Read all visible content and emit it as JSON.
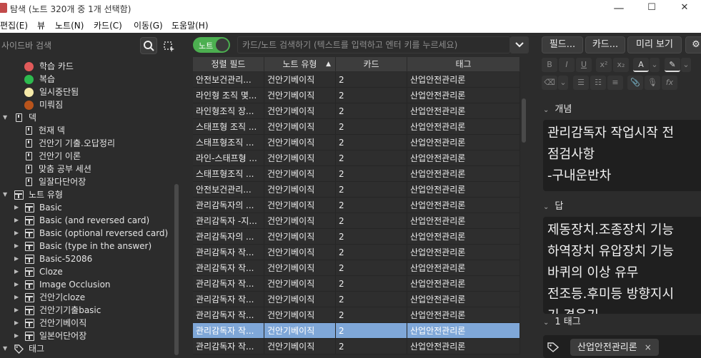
{
  "window": {
    "title": "탐색 (노트 320개 중 1개 선택함)",
    "minimize": "—",
    "maximize": "☐",
    "close": "✕"
  },
  "menu": [
    "편집(E)",
    "뷰",
    "노트(N)",
    "카드(C)",
    "이동(G)",
    "도움말(H)"
  ],
  "sidebar": {
    "search_placeholder": "사이드바 검색",
    "items": [
      {
        "label": "학습 카드",
        "icon": "red-dot-icon",
        "color": "#e05a5a"
      },
      {
        "label": "복습",
        "icon": "green-dot-icon",
        "color": "#2dba4e"
      },
      {
        "label": "일시중단됨",
        "icon": "yellow-dot-icon",
        "color": "#f5e9a8"
      },
      {
        "label": "미뤄짐",
        "icon": "brown-dot-icon",
        "color": "#b9541b"
      },
      {
        "label": "덱",
        "icon": "deck-icon"
      },
      {
        "label": "현재 덱",
        "icon": "current-deck-icon"
      },
      {
        "label": "건안기 기출.오답정리",
        "icon": "deck-icon"
      },
      {
        "label": "건안기 이론",
        "icon": "deck-icon"
      },
      {
        "label": "맞춤 공부 세션",
        "icon": "filtered-deck-icon"
      },
      {
        "label": "일잘다단어장",
        "icon": "deck-icon"
      },
      {
        "label": "노트 유형",
        "icon": "note-type-icon"
      },
      {
        "label": "Basic",
        "icon": "note-type-icon"
      },
      {
        "label": "Basic (and reversed card)",
        "icon": "note-type-icon"
      },
      {
        "label": "Basic (optional reversed card)",
        "icon": "note-type-icon"
      },
      {
        "label": "Basic (type in the answer)",
        "icon": "note-type-icon"
      },
      {
        "label": "Basic-52086",
        "icon": "note-type-icon"
      },
      {
        "label": "Cloze",
        "icon": "note-type-icon"
      },
      {
        "label": "Image Occlusion",
        "icon": "note-type-icon"
      },
      {
        "label": "건안기cloze",
        "icon": "note-type-icon"
      },
      {
        "label": "건안기기출basic",
        "icon": "note-type-icon"
      },
      {
        "label": "건안기베이직",
        "icon": "note-type-icon"
      },
      {
        "label": "일본어단어장",
        "icon": "note-type-icon"
      },
      {
        "label": "태그",
        "icon": "tag-icon"
      }
    ]
  },
  "browser": {
    "toggle_label": "노트",
    "search_placeholder": "카드/노트 검색하기 (텍스트를 입력하고 엔터 키를 누르세요)",
    "columns": [
      "정렬 필드",
      "노트 유형",
      "카드",
      "태그"
    ],
    "sort_indicator": "▲",
    "rows": [
      [
        "안전보건관리...",
        "건안기베이직",
        "2",
        "산업안전관리론"
      ],
      [
        "라인형 조직 몇...",
        "건안기베이직",
        "2",
        "산업안전관리론"
      ],
      [
        "라인형조직 장...",
        "건안기베이직",
        "2",
        "산업안전관리론"
      ],
      [
        "스태프형 조직 ...",
        "건안기베이직",
        "2",
        "산업안전관리론"
      ],
      [
        "스태프형조직 ...",
        "건안기베이직",
        "2",
        "산업안전관리론"
      ],
      [
        "라인-스태프형 ...",
        "건안기베이직",
        "2",
        "산업안전관리론"
      ],
      [
        "스태프형조직 ...",
        "건안기베이직",
        "2",
        "산업안전관리론"
      ],
      [
        "안전보건관리...",
        "건안기베이직",
        "2",
        "산업안전관리론"
      ],
      [
        "관리감독자의 ...",
        "건안기베이직",
        "2",
        "산업안전관리론"
      ],
      [
        "관리감독자 -지...",
        "건안기베이직",
        "2",
        "산업안전관리론"
      ],
      [
        "관리감독자의 ...",
        "건안기베이직",
        "2",
        "산업안전관리론"
      ],
      [
        "관리감독자 작...",
        "건안기베이직",
        "2",
        "산업안전관리론"
      ],
      [
        "관리감독자 작...",
        "건안기베이직",
        "2",
        "산업안전관리론"
      ],
      [
        "관리감독자 작...",
        "건안기베이직",
        "2",
        "산업안전관리론"
      ],
      [
        "관리감독자 작...",
        "건안기베이직",
        "2",
        "산업안전관리론"
      ],
      [
        "관리감독자 작...",
        "건안기베이직",
        "2",
        "산업안전관리론"
      ],
      [
        "관리감독자 작...",
        "건안기베이직",
        "2",
        "산업안전관리론"
      ],
      [
        "관리감독자 작...",
        "건안기베이직",
        "2",
        "산업안전관리론"
      ]
    ],
    "selected_row": 16
  },
  "editor": {
    "buttons": [
      "필드...",
      "카드...",
      "미리 보기"
    ],
    "gear": "⚙",
    "format_row1": [
      "B",
      "I",
      "U",
      "x²",
      "x₂",
      "A",
      "⌄",
      "✎",
      "⌄"
    ],
    "format_row2": [
      "⌫",
      "⌄",
      "☰",
      "☷",
      "≡",
      "📎",
      "🎙",
      "fx"
    ],
    "fields": [
      {
        "name": "개념",
        "lines": [
          "관리감독자 작업시작 전",
          "점검사항",
          "-구내운반차"
        ]
      },
      {
        "name": "답",
        "lines": [
          "제동장치.조종장치 기능",
          "하역장치 유압장치 기능",
          "바퀴의 이상 유무",
          "전조등.후미등 방향지시",
          "기 경음기"
        ]
      }
    ],
    "tags_header": "1 태그",
    "tag": "산업안전관리론",
    "tag_remove": "×"
  }
}
